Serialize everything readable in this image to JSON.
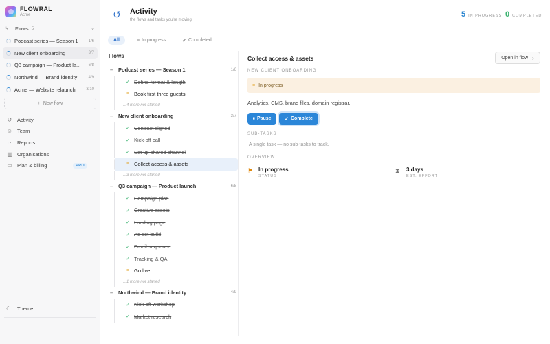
{
  "brand": {
    "name": "FLOWRAL",
    "sub": "Acme"
  },
  "sidebar": {
    "flows_label": "Flows",
    "flows_count": "5",
    "flows": [
      {
        "name": "Podcast series — Season 1",
        "count": "1/6"
      },
      {
        "name": "New client onboarding",
        "count": "3/7"
      },
      {
        "name": "Q3 campaign — Product la...",
        "count": "6/8"
      },
      {
        "name": "Northwind — Brand identity",
        "count": "4/9"
      },
      {
        "name": "Acme — Website relaunch",
        "count": "3/10"
      }
    ],
    "new_flow": "New flow",
    "nav": [
      {
        "label": "Activity"
      },
      {
        "label": "Team"
      },
      {
        "label": "Reports"
      },
      {
        "label": "Organisations"
      },
      {
        "label": "Plan & billing",
        "badge": "PRO"
      }
    ],
    "theme": "Theme"
  },
  "header": {
    "title": "Activity",
    "subtitle": "the flows and tasks you're moving",
    "in_progress_count": "5",
    "in_progress_label": "IN PROGRESS",
    "completed_count": "0",
    "completed_label": "COMPLETED"
  },
  "tabs": [
    {
      "label": "All"
    },
    {
      "label": "In progress"
    },
    {
      "label": "Completed"
    }
  ],
  "flows_panel": {
    "title": "Flows",
    "groups": [
      {
        "name": "Podcast series — Season 1",
        "count": "1/6",
        "tasks": [
          {
            "name": "Define format & length",
            "state": "done"
          },
          {
            "name": "Book first three guests",
            "state": "progress"
          }
        ],
        "more": "...4 more not started"
      },
      {
        "name": "New client onboarding",
        "count": "3/7",
        "tasks": [
          {
            "name": "Contract signed",
            "state": "done"
          },
          {
            "name": "Kick-off call",
            "state": "done"
          },
          {
            "name": "Set up shared channel",
            "state": "done"
          },
          {
            "name": "Collect access & assets",
            "state": "progress"
          }
        ],
        "more": "...3 more not started"
      },
      {
        "name": "Q3 campaign — Product launch",
        "count": "6/8",
        "tasks": [
          {
            "name": "Campaign plan",
            "state": "done"
          },
          {
            "name": "Creative assets",
            "state": "done"
          },
          {
            "name": "Landing page",
            "state": "done"
          },
          {
            "name": "Ad set build",
            "state": "done"
          },
          {
            "name": "Email sequence",
            "state": "done"
          },
          {
            "name": "Tracking & QA",
            "state": "done"
          },
          {
            "name": "Go live",
            "state": "progress"
          }
        ],
        "more": "...1 more not started"
      },
      {
        "name": "Northwind — Brand identity",
        "count": "4/9",
        "tasks": [
          {
            "name": "Kick-off workshop",
            "state": "done"
          },
          {
            "name": "Market research",
            "state": "done"
          }
        ]
      }
    ]
  },
  "detail": {
    "title": "Collect access & assets",
    "open_button": "Open in flow",
    "flow_name": "NEW CLIENT ONBOARDING",
    "status": "In progress",
    "description": "Analytics, CMS, brand files, domain registrar.",
    "pause_label": "Pause",
    "complete_label": "Complete",
    "subtasks_label": "SUB-TASKS",
    "subtasks_empty": "A single task — no sub-tasks to track.",
    "overview_label": "OVERVIEW",
    "overview": [
      {
        "value": "In progress",
        "label": "STATUS"
      },
      {
        "value": "3 days",
        "label": "EST. EFFORT"
      }
    ]
  },
  "colors": {
    "accent": "#2b86d8",
    "progress": "#e0a020",
    "done": "#3cb371"
  }
}
